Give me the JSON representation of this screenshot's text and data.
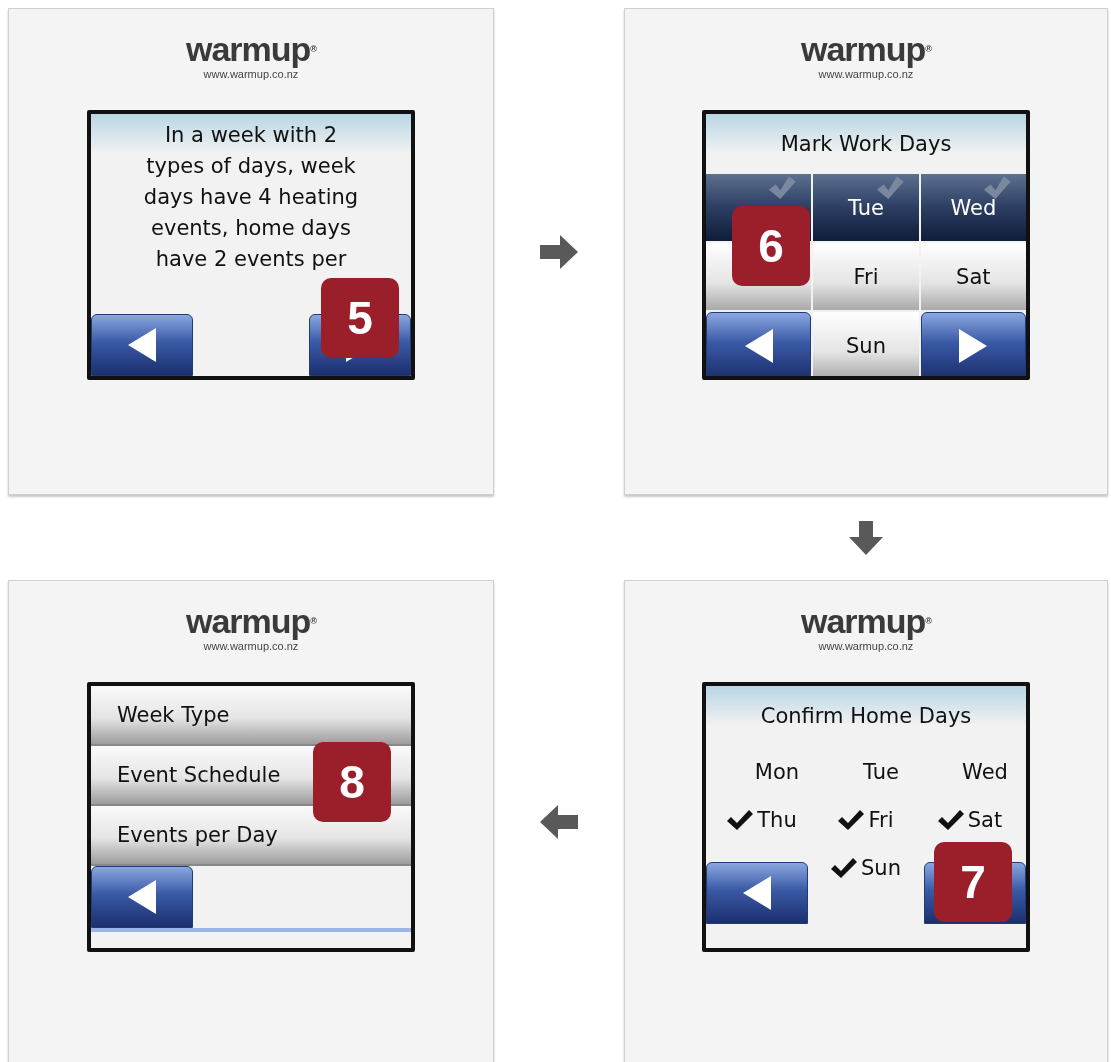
{
  "panels": [
    {
      "kind": "message",
      "logo": "warmup$^{®}$",
      "url": "www.warmup.co.nz",
      "badge": "5",
      "lines": [
        "In a week with 2",
        "types of days, week",
        "days have 4 heating",
        "events, home days",
        "have 2 events per"
      ],
      "buttons": [
        {
          "kind": "back"
        },
        {
          "kind": "next"
        }
      ]
    },
    {
      "kind": "day_select",
      "logo": "warmup$^{®}$",
      "url": "www.warmup.co.nz",
      "badge": "6",
      "title": "Mark Work Days",
      "days": [
        {
          "selected": true
        },
        {
          "label": "Tue",
          "selected": true
        },
        {
          "label": "Wed",
          "selected": true
        },
        {
          "selected": false
        },
        {
          "label": "Fri",
          "selected": false
        },
        {
          "label": "Sat",
          "selected": false
        },
        {
          "kind": "back"
        },
        {
          "label": "Sun",
          "selected": false
        },
        {
          "kind": "next"
        }
      ]
    },
    {
      "kind": "menu",
      "logo": "warmup$^{®}$",
      "url": "www.warmup.co.nz",
      "badge": "8",
      "items": [
        "Week Type",
        "Event Schedule",
        "Events per Day"
      ],
      "buttons": [
        {
          "kind": "back"
        }
      ]
    },
    {
      "kind": "day_confirm",
      "logo": "warmup$^{®}$",
      "url": "www.warmup.co.nz",
      "badge": "7",
      "title": "Confirm Home Days",
      "days": [
        {
          "label": "Mon",
          "checked": false
        },
        {
          "label": "Tue",
          "checked": false
        },
        {
          "label": "Wed",
          "checked": false
        },
        {
          "label": "Thu",
          "checked": true
        },
        {
          "label": "Fri",
          "checked": true
        },
        {
          "label": "Sat",
          "checked": true
        },
        {
          "label": "Sun",
          "checked": true
        }
      ],
      "buttons": [
        {
          "kind": "back"
        },
        {
          "kind": "next"
        }
      ]
    }
  ],
  "flow_arrows": [
    {
      "kind": "right"
    },
    {
      "kind": "down"
    },
    {
      "kind": "left"
    }
  ]
}
